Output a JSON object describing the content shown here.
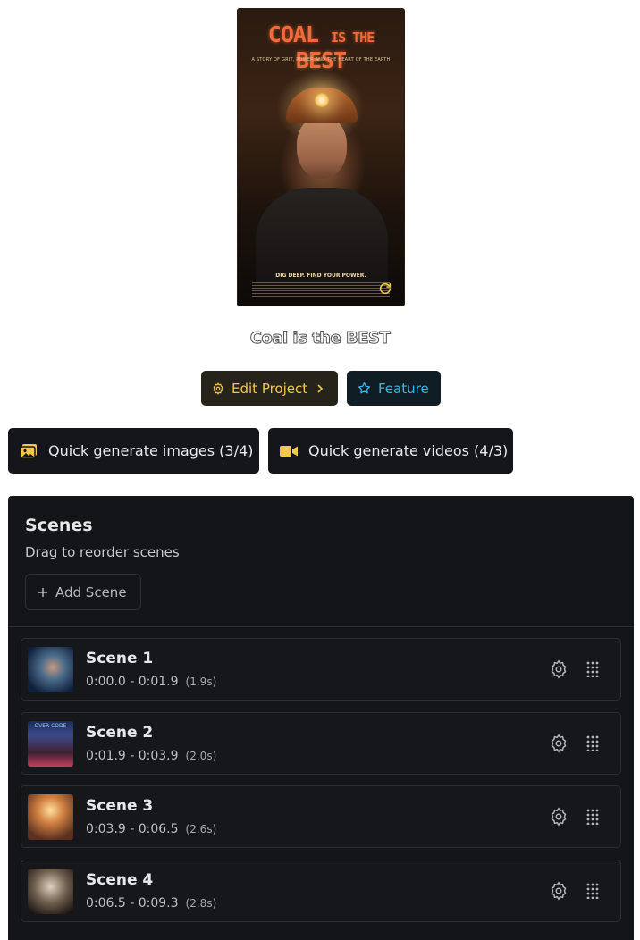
{
  "poster": {
    "title_word1": "COAL",
    "title_word2": "IS THE",
    "title_word3": "BEST",
    "tagline": "A STORY OF GRIT, POWER AND THE HEART OF THE EARTH",
    "footer_line": "DIG DEEP. FIND YOUR POWER.",
    "regenerate_icon": "refresh-icon"
  },
  "project": {
    "title": "Coal is the BEST"
  },
  "actions": {
    "edit_label": "Edit Project",
    "feature_label": "Feature",
    "quick_images_label": "Quick generate images (3/4)",
    "quick_videos_label": "Quick generate videos (4/3)"
  },
  "scenes_panel": {
    "title": "Scenes",
    "subtitle": "Drag to reorder scenes",
    "add_label": "Add Scene",
    "items": [
      {
        "name": "Scene 1",
        "range": "0:00.0 - 0:01.9",
        "duration": "(1.9s)"
      },
      {
        "name": "Scene 2",
        "range": "0:01.9 - 0:03.9",
        "duration": "(2.0s)",
        "thumb_text": "OVER CODE"
      },
      {
        "name": "Scene 3",
        "range": "0:03.9 - 0:06.5",
        "duration": "(2.6s)"
      },
      {
        "name": "Scene 4",
        "range": "0:06.5 - 0:09.3",
        "duration": "(2.8s)"
      }
    ]
  },
  "colors": {
    "accent_yellow": "#f2c94c",
    "accent_blue": "#38b6e8",
    "panel_bg": "#131518"
  }
}
